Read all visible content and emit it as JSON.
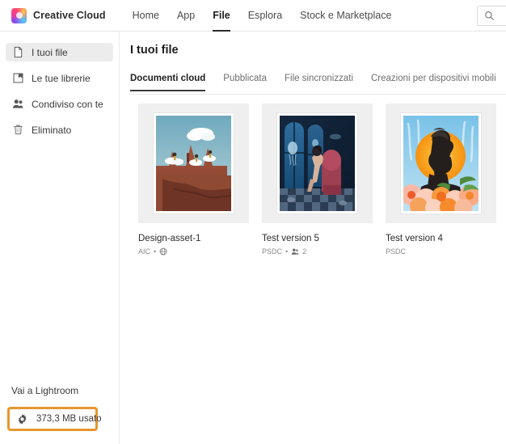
{
  "topnav": {
    "brand": "Creative Cloud",
    "brand_icon": "creative-cloud-logo",
    "links": [
      {
        "label": "Home",
        "active": false
      },
      {
        "label": "App",
        "active": false
      },
      {
        "label": "File",
        "active": true
      },
      {
        "label": "Esplora",
        "active": false
      },
      {
        "label": "Stock e Marketplace",
        "active": false
      }
    ],
    "search": {
      "icon": "search-icon",
      "value": "",
      "placeholder": ""
    }
  },
  "sidebar": {
    "items": [
      {
        "label": "I tuoi file",
        "icon": "document-icon",
        "selected": true
      },
      {
        "label": "Le tue librerie",
        "icon": "library-icon",
        "selected": false
      },
      {
        "label": "Condiviso con te",
        "icon": "people-icon",
        "selected": false
      },
      {
        "label": "Eliminato",
        "icon": "trash-icon",
        "selected": false
      }
    ],
    "footer": {
      "lightroom_link": "Vai a Lightroom",
      "storage": {
        "icon": "gear-icon",
        "label": "373,3 MB usato",
        "highlight_color": "#e8962e"
      }
    }
  },
  "main": {
    "title": "I tuoi file",
    "tabs": [
      {
        "label": "Documenti cloud",
        "active": true
      },
      {
        "label": "Pubblicata",
        "active": false
      },
      {
        "label": "File sincronizzati",
        "active": false
      },
      {
        "label": "Creazioni per dispositivi mobili",
        "active": false
      }
    ],
    "files": [
      {
        "title": "Design-asset-1",
        "format": "AIC",
        "separator": "•",
        "shared_icon": "globe-icon",
        "shared_count": "",
        "thumb": "desert-canyon-artwork"
      },
      {
        "title": "Test version 5",
        "format": "PSDC",
        "separator": "•",
        "shared_icon": "people-icon",
        "shared_count": "2",
        "thumb": "underwater-room-artwork"
      },
      {
        "title": "Test version 4",
        "format": "PSDC",
        "separator": "",
        "shared_icon": "",
        "shared_count": "",
        "thumb": "bust-sun-flowers-artwork"
      }
    ]
  }
}
